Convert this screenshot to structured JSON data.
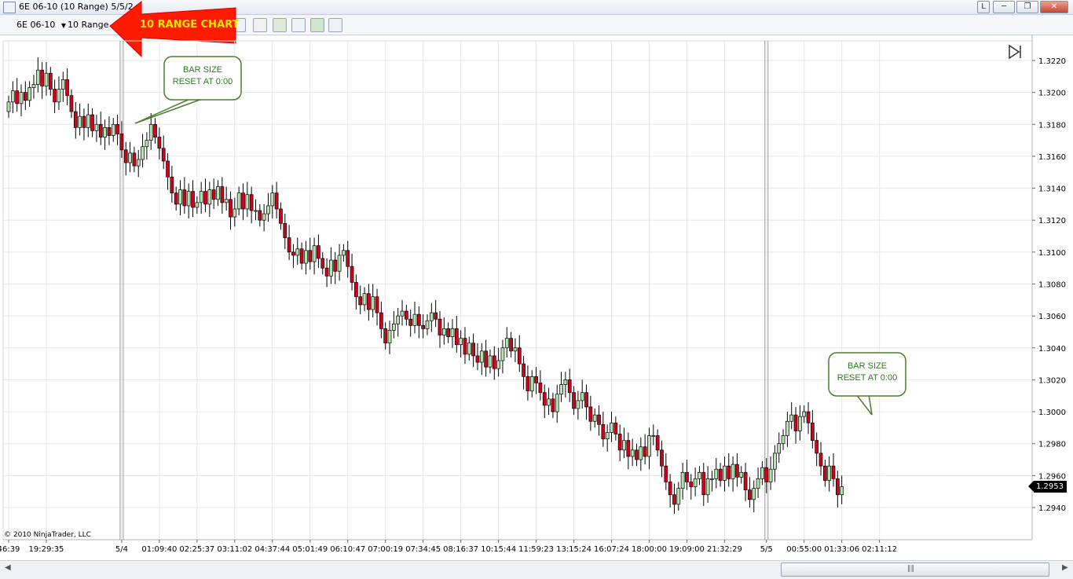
{
  "window": {
    "title": "6E 06-10 (10 Range)  5/5/2",
    "btn_l": "L"
  },
  "toolbar": {
    "instrument": "6E 06-10",
    "interval": "10 Range",
    "annotation_arrow": "10 RANGE CHART"
  },
  "chart": {
    "copyright": "© 2010 NinjaTrader, LLC",
    "last_price": "1.2953",
    "callout_top": [
      "BAR SIZE",
      "RESET AT 0:00"
    ],
    "callout_bottom": [
      "BAR SIZE",
      "RESET AT 0:00"
    ],
    "colors": {
      "up": "#b7e3b0",
      "down": "#d0021b",
      "grid": "#e6e6e6",
      "callout_border": "#4a7d2a",
      "callout_text": "#2a7a1a"
    }
  },
  "chart_data": {
    "type": "candlestick",
    "instrument": "6E 06-10",
    "y_ticks": [
      "1.3220",
      "1.3200",
      "1.3180",
      "1.3160",
      "1.3140",
      "1.3120",
      "1.3100",
      "1.3080",
      "1.3060",
      "1.3040",
      "1.3020",
      "1.3000",
      "1.2980",
      "1.2960",
      "1.2940"
    ],
    "ylim": [
      1.2927,
      1.3236
    ],
    "x_ticks": [
      {
        "label": "46:39",
        "bar": 0
      },
      {
        "label": "19:29:35",
        "bar": 9
      },
      {
        "label": "5/4",
        "bar": 27
      },
      {
        "label": "01:09:40",
        "bar": 36
      },
      {
        "label": "02:25:37",
        "bar": 45
      },
      {
        "label": "03:11:02",
        "bar": 54
      },
      {
        "label": "04:37:44",
        "bar": 63
      },
      {
        "label": "05:01:49",
        "bar": 72
      },
      {
        "label": "06:10:47",
        "bar": 81
      },
      {
        "label": "07:00:19",
        "bar": 90
      },
      {
        "label": "07:34:45",
        "bar": 99
      },
      {
        "label": "08:16:37",
        "bar": 108
      },
      {
        "label": "10:15:44",
        "bar": 117
      },
      {
        "label": "11:59:23",
        "bar": 126
      },
      {
        "label": "13:15:24",
        "bar": 135
      },
      {
        "label": "16:07:24",
        "bar": 144
      },
      {
        "label": "18:00:00",
        "bar": 153
      },
      {
        "label": "19:09:00",
        "bar": 162
      },
      {
        "label": "21:32:29",
        "bar": 171
      },
      {
        "label": "5/5",
        "bar": 181
      },
      {
        "label": "00:55:00",
        "bar": 190
      },
      {
        "label": "01:33:06",
        "bar": 199
      },
      {
        "label": "02:11:12",
        "bar": 208
      }
    ],
    "session_breaks": [
      27,
      181
    ],
    "closes": [
      1.3194,
      1.3201,
      1.3193,
      1.32,
      1.3195,
      1.3203,
      1.3205,
      1.3214,
      1.3204,
      1.3212,
      1.3202,
      1.3194,
      1.3202,
      1.3208,
      1.3198,
      1.3188,
      1.3178,
      1.3185,
      1.3178,
      1.3186,
      1.3176,
      1.318,
      1.3172,
      1.3178,
      1.3173,
      1.318,
      1.3174,
      1.3164,
      1.3156,
      1.3162,
      1.3154,
      1.3158,
      1.3166,
      1.317,
      1.318,
      1.3172,
      1.3165,
      1.3157,
      1.3147,
      1.3137,
      1.313,
      1.3139,
      1.3129,
      1.3138,
      1.3128,
      1.3131,
      1.3138,
      1.313,
      1.3139,
      1.3133,
      1.3141,
      1.3131,
      1.3133,
      1.3122,
      1.3127,
      1.3137,
      1.3127,
      1.3136,
      1.3126,
      1.3126,
      1.312,
      1.3124,
      1.3129,
      1.3137,
      1.3127,
      1.3118,
      1.3109,
      1.31,
      1.3098,
      1.3102,
      1.3093,
      1.3101,
      1.3094,
      1.3104,
      1.3096,
      1.309,
      1.3085,
      1.3095,
      1.3088,
      1.3098,
      1.3101,
      1.3091,
      1.3081,
      1.3072,
      1.3067,
      1.3074,
      1.3064,
      1.3072,
      1.3062,
      1.3052,
      1.3043,
      1.3051,
      1.3055,
      1.306,
      1.3063,
      1.3058,
      1.3054,
      1.3061,
      1.3054,
      1.3052,
      1.3057,
      1.3062,
      1.3058,
      1.3048,
      1.3052,
      1.3047,
      1.3052,
      1.3042,
      1.3046,
      1.3036,
      1.3043,
      1.3035,
      1.3031,
      1.3038,
      1.3028,
      1.3035,
      1.3027,
      1.3032,
      1.304,
      1.3046,
      1.3038,
      1.304,
      1.303,
      1.3022,
      1.3013,
      1.3022,
      1.3018,
      1.3012,
      1.3004,
      1.3008,
      1.3,
      1.3011,
      1.3017,
      1.302,
      1.3012,
      1.3002,
      1.3007,
      1.3012,
      1.3003,
      1.2994,
      1.2998,
      1.2992,
      1.2983,
      1.2987,
      1.2993,
      1.2986,
      1.2976,
      1.2982,
      1.2972,
      1.2976,
      1.297,
      1.2978,
      1.2972,
      1.2985,
      1.2985,
      1.2976,
      1.2966,
      1.2956,
      1.2948,
      1.2942,
      1.2952,
      1.2962,
      1.2956,
      1.2953,
      1.2958,
      1.2962,
      1.2948,
      1.2958,
      1.2958,
      1.2964,
      1.2957,
      1.2966,
      1.2958,
      1.2967,
      1.2959,
      1.2962,
      1.2951,
      1.2945,
      1.2952,
      1.2958,
      1.2965,
      1.2956,
      1.2964,
      1.2974,
      1.298,
      1.2985,
      1.2994,
      1.2998,
      1.2988,
      1.2997,
      1.3,
      1.2993,
      1.2982,
      1.2974,
      1.2966,
      1.2957,
      1.2966,
      1.2958,
      1.2948,
      1.2953
    ]
  }
}
